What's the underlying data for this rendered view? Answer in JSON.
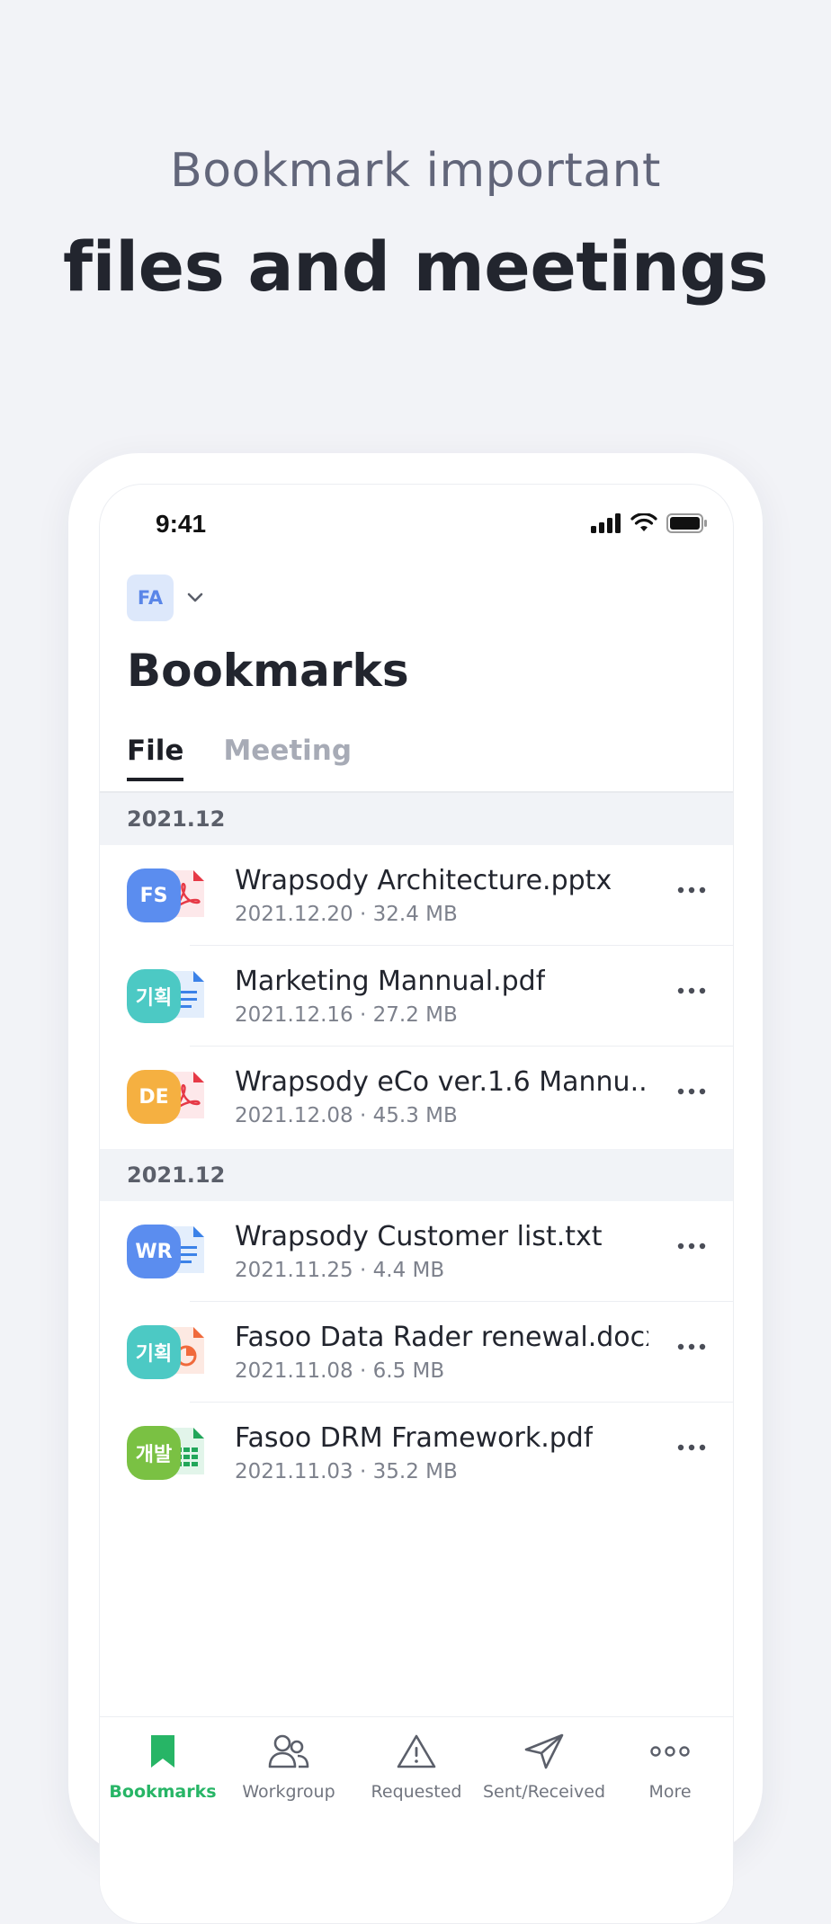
{
  "promo": {
    "subtitle": "Bookmark important",
    "title": "files and meetings"
  },
  "status_bar": {
    "time": "9:41"
  },
  "account": {
    "initials": "FA"
  },
  "page": {
    "title": "Bookmarks"
  },
  "tabs": [
    {
      "label": "File",
      "active": true
    },
    {
      "label": "Meeting",
      "active": false
    }
  ],
  "sections": [
    {
      "header": "2021.12",
      "items": [
        {
          "owner": "FS",
          "owner_color": "#5b8def",
          "type": "pdf-icon",
          "name": "Wrapsody Architecture.pptx",
          "date": "2021.12.20",
          "size": "32.4 MB"
        },
        {
          "owner": "기획",
          "owner_color": "#4cc9c4",
          "type": "doc-icon",
          "name": "Marketing Mannual.pdf",
          "date": "2021.12.16",
          "size": "27.2 MB"
        },
        {
          "owner": "DE",
          "owner_color": "#f5b041",
          "type": "pdf-icon",
          "name": "Wrapsody eCo ver.1.6 Mannu...",
          "date": "2021.12.08",
          "size": "45.3 MB"
        }
      ]
    },
    {
      "header": "2021.12",
      "items": [
        {
          "owner": "WR",
          "owner_color": "#5b8def",
          "type": "doc-icon",
          "name": "Wrapsody Customer list.txt",
          "date": "2021.11.25",
          "size": "4.4 MB"
        },
        {
          "owner": "기획",
          "owner_color": "#4cc9c4",
          "type": "ppt-icon",
          "name": "Fasoo Data Rader renewal.docx",
          "date": "2021.11.08",
          "size": "6.5 MB"
        },
        {
          "owner": "개발",
          "owner_color": "#7ac143",
          "type": "sheet-icon",
          "name": "Fasoo DRM Framework.pdf",
          "date": "2021.11.03",
          "size": "35.2 MB"
        }
      ]
    }
  ],
  "meta_separator": "·",
  "bottom_nav": [
    {
      "label": "Bookmarks",
      "icon": "bookmark-icon",
      "active": true
    },
    {
      "label": "Workgroup",
      "icon": "people-icon",
      "active": false
    },
    {
      "label": "Requested",
      "icon": "warning-icon",
      "active": false
    },
    {
      "label": "Sent/Received",
      "icon": "send-icon",
      "active": false
    },
    {
      "label": "More",
      "icon": "more-dots-icon",
      "active": false
    }
  ],
  "colors": {
    "accent": "#27b566",
    "pdf_red": "#e63946",
    "doc_blue": "#3b82e8",
    "sheet_green": "#22a65a",
    "ppt_orange": "#f06a3c"
  }
}
